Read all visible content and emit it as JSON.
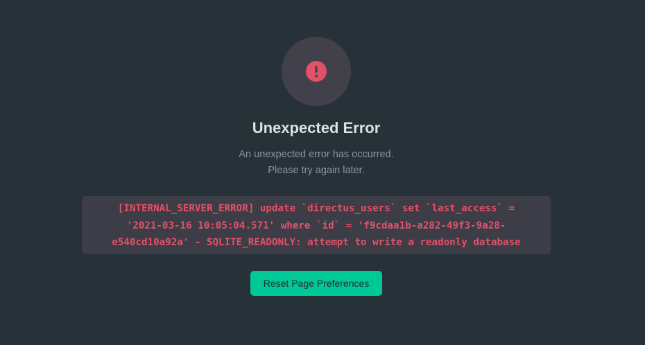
{
  "error": {
    "icon": "alert-circle-icon",
    "title": "Unexpected Error",
    "message_line_1": "An unexpected error has occurred.",
    "message_line_2": "Please try again later.",
    "details": "[INTERNAL_SERVER_ERROR] update `directus_users` set `last_access` =\n'2021-03-16 10:05:04.571' where `id` = 'f9cdaa1b-a282-49f3-9a28-\ne540cd10a92a' - SQLITE_READONLY: attempt to write a readonly database"
  },
  "actions": {
    "reset_label": "Reset Page Preferences"
  },
  "colors": {
    "background": "#263238",
    "icon_circle": "#42414b",
    "danger": "#e35169",
    "primary_button": "#00c897"
  }
}
